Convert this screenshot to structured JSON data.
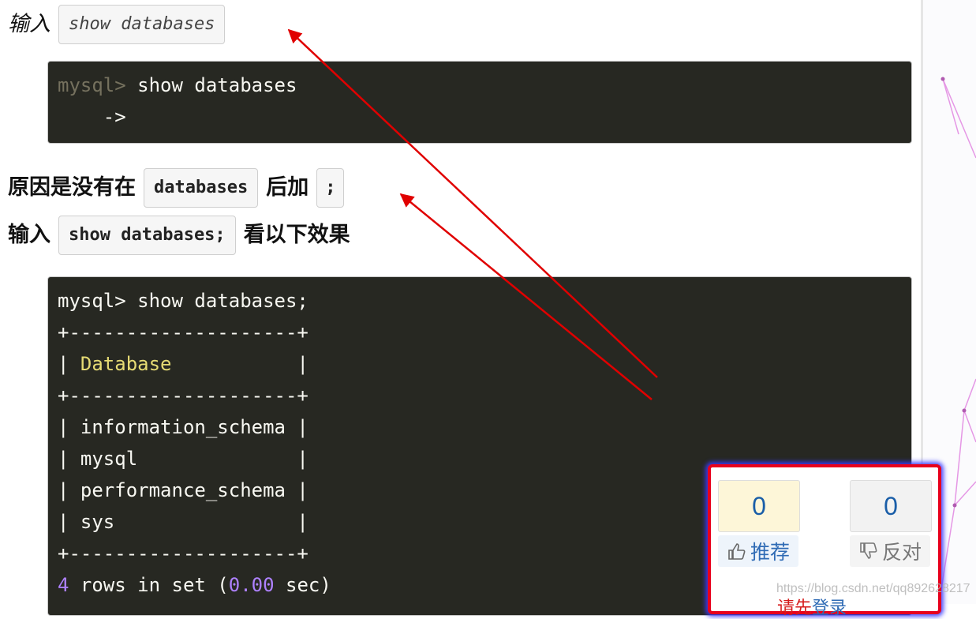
{
  "intro": {
    "label": "输入",
    "command": "show databases"
  },
  "code1": {
    "prompt": "mysql>",
    "command": " show databases",
    "continuation": "    ->"
  },
  "reason": {
    "text_before": "原因是没有在",
    "chip1": "databases",
    "text_mid": "后加",
    "chip2": ";"
  },
  "retry": {
    "label": "输入",
    "chip": "show databases;",
    "text_after": "看以下效果"
  },
  "code2": {
    "prompt_line": "mysql> show databases;",
    "border": "+--------------------+",
    "header_pipe_left": "| ",
    "header": "Database",
    "header_pipe_right": "           |",
    "rows": [
      "| information_schema |",
      "| mysql              |",
      "| performance_schema |",
      "| sys                |"
    ],
    "footer": {
      "count": "4",
      "middle": " rows in set (",
      "time": "0.00",
      "end": " sec)"
    }
  },
  "votes": {
    "up_count": "0",
    "down_count": "0",
    "up_label": "推荐",
    "down_label": "反对",
    "login_prefix": "请先",
    "login_link": "登录"
  },
  "watermark": "https://blog.csdn.net/qq892628217",
  "colors": {
    "code_bg": "#272822",
    "annotation_arrow": "#e00000",
    "panel_border": "#e8001c"
  }
}
